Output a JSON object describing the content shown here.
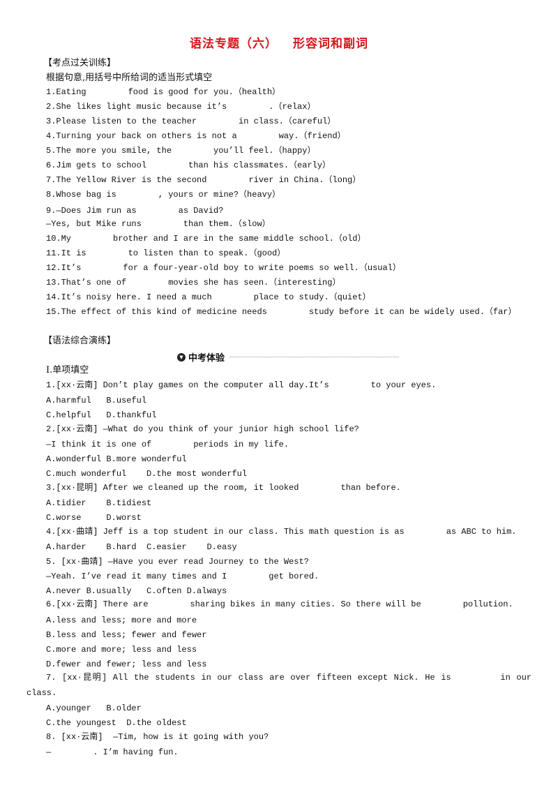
{
  "title": {
    "part1": "语法专题（六）",
    "part2": "形容词和副词"
  },
  "section1": {
    "header": "【考点过关训练】",
    "instruction": "根据句意,用括号中所给词的适当形式填空",
    "items": [
      [
        "1.Eating",
        "food is good for you.（health）"
      ],
      [
        "2.She likes light music because it’s",
        ".（relax）"
      ],
      [
        "3.Please listen to the teacher",
        "in class.（careful）"
      ],
      [
        "4.Turning your back on others is not a",
        "way.（friend）"
      ],
      [
        "5.The more you smile, the",
        "you’ll feel.（happy）"
      ],
      [
        "6.Jim gets to school",
        "than his classmates.（early）"
      ],
      [
        "7.The Yellow River is the second",
        "river in China.（long）"
      ],
      [
        "8.Whose bag is",
        ", yours or mine?（heavy）"
      ],
      [
        "9.—Does Jim run as",
        "as David?"
      ],
      [
        "—Yes, but Mike runs",
        "than them.（slow）"
      ],
      [
        "10.My",
        "brother and I are in the same middle school.（old）"
      ],
      [
        "11.It is",
        "to listen than to speak.（good）"
      ],
      [
        "12.It’s",
        "for a four-year-old boy to write poems so well.（usual）"
      ],
      [
        "13.That’s one of",
        "movies she has seen.（interesting）"
      ],
      [
        "14.It’s noisy here. I need a much",
        "place to study.（quiet）"
      ],
      [
        "15.The effect of this kind of medicine needs",
        "study before it can be widely used.（far）"
      ]
    ]
  },
  "section2": {
    "header": "【语法综合演练】",
    "subheader": "中考体验",
    "part": "Ⅰ.单项填空",
    "lines": [
      [
        "1.[xx·云南] Don’t play games on the computer all day.It’s",
        "to your eyes."
      ],
      [
        "A.harmful   B.useful"
      ],
      [
        "C.helpful   D.thankful"
      ],
      [
        "2.[xx·云南] —What do you think of your junior high school life?"
      ],
      [
        "—I think it is one of",
        "periods in my life."
      ],
      [
        "A.wonderful B.more wonderful"
      ],
      [
        "C.much wonderful    D.the most wonderful"
      ],
      [
        "3.[xx·昆明] After we cleaned up the room, it looked",
        "than before."
      ],
      [
        "A.tidier    B.tidiest"
      ],
      [
        "C.worse     D.worst"
      ],
      [
        "4.[xx·曲靖] Jeff is a top student in our class. This math question is as",
        "as ABC to him."
      ],
      [
        "A.harder    B.hard  C.easier    D.easy"
      ],
      [
        "5. [xx·曲靖] —Have you ever read Journey to the West?"
      ],
      [
        "—Yeah. I’ve read it many times and I",
        "get bored."
      ],
      [
        "A.never B.usually   C.often D.always"
      ],
      [
        "6.[xx·云南] There are",
        "sharing bikes in many cities. So there will be",
        "pollution."
      ],
      [
        "A.less and less; more and more"
      ],
      [
        "B.less and less; fewer and fewer"
      ],
      [
        "C.more and more; less and less"
      ],
      [
        "D.fewer and fewer; less and less"
      ]
    ],
    "q7": {
      "line1": "7. [xx·昆明] All the students in our class are over fifteen except Nick. He is 　　　　 in our",
      "line2": "class.",
      "opts": [
        [
          "A.younger   B.older"
        ],
        [
          "C.the youngest  D.the oldest"
        ]
      ]
    },
    "q8": [
      [
        "8. [xx·云南]  —Tim, how is it going with you?"
      ],
      [
        "—",
        ". I’m having fun."
      ]
    ]
  }
}
